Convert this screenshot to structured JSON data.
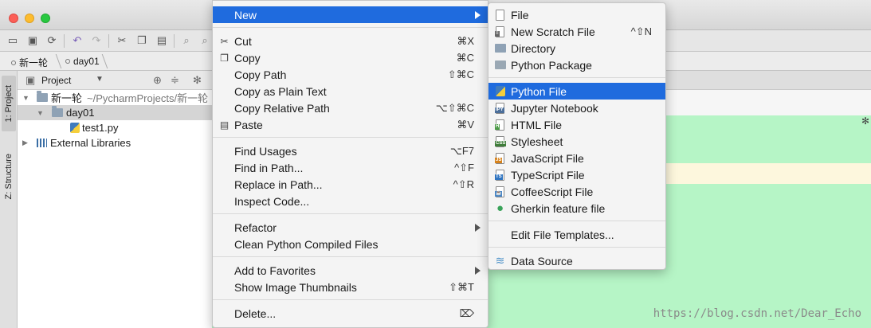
{
  "project_panel": {
    "title": "Project",
    "tree": [
      {
        "label": "新一轮",
        "sub": "~/PycharmProjects/新一轮"
      },
      {
        "label": "day01"
      },
      {
        "label": "test1.py"
      },
      {
        "label": "External Libraries"
      }
    ]
  },
  "breadcrumb": [
    "新一轮",
    "day01"
  ],
  "side_tabs": [
    "1: Project",
    "Z: Structure"
  ],
  "context_menu": {
    "new": {
      "label": "New"
    },
    "cut": {
      "label": "Cut",
      "shortcut": "⌘X"
    },
    "copy": {
      "label": "Copy",
      "shortcut": "⌘C"
    },
    "copy_path": {
      "label": "Copy Path",
      "shortcut": "⇧⌘C"
    },
    "copy_plain": {
      "label": "Copy as Plain Text"
    },
    "copy_relative": {
      "label": "Copy Relative Path",
      "shortcut": "⌥⇧⌘C"
    },
    "paste": {
      "label": "Paste",
      "shortcut": "⌘V"
    },
    "find_usages": {
      "label": "Find Usages",
      "shortcut": "⌥F7"
    },
    "find_in_path": {
      "label": "Find in Path...",
      "shortcut": "^⇧F"
    },
    "replace_in_path": {
      "label": "Replace in Path...",
      "shortcut": "^⇧R"
    },
    "inspect_code": {
      "label": "Inspect Code..."
    },
    "refactor": {
      "label": "Refactor"
    },
    "clean_python": {
      "label": "Clean Python Compiled Files"
    },
    "add_favorites": {
      "label": "Add to Favorites"
    },
    "show_thumbnails": {
      "label": "Show Image Thumbnails",
      "shortcut": "⇧⌘T"
    },
    "delete": {
      "label": "Delete...",
      "shortcut": "⌦"
    }
  },
  "new_submenu": {
    "file": {
      "label": "File"
    },
    "scratch": {
      "label": "New Scratch File",
      "shortcut": "^⇧N"
    },
    "directory": {
      "label": "Directory"
    },
    "python_package": {
      "label": "Python Package"
    },
    "python_file": {
      "label": "Python File"
    },
    "jupyter": {
      "label": "Jupyter Notebook"
    },
    "html": {
      "label": "HTML File"
    },
    "stylesheet": {
      "label": "Stylesheet"
    },
    "javascript": {
      "label": "JavaScript File"
    },
    "typescript": {
      "label": "TypeScript File"
    },
    "coffeescript": {
      "label": "CoffeeScript File"
    },
    "gherkin": {
      "label": "Gherkin feature file"
    },
    "edit_templates": {
      "label": "Edit File Templates..."
    },
    "data_source": {
      "label": "Data Source"
    }
  },
  "watermark": "https://blog.csdn.net/Dear_Echo",
  "colors": {
    "highlight": "#1f6bde",
    "editor_green": "#b6f5c6"
  }
}
